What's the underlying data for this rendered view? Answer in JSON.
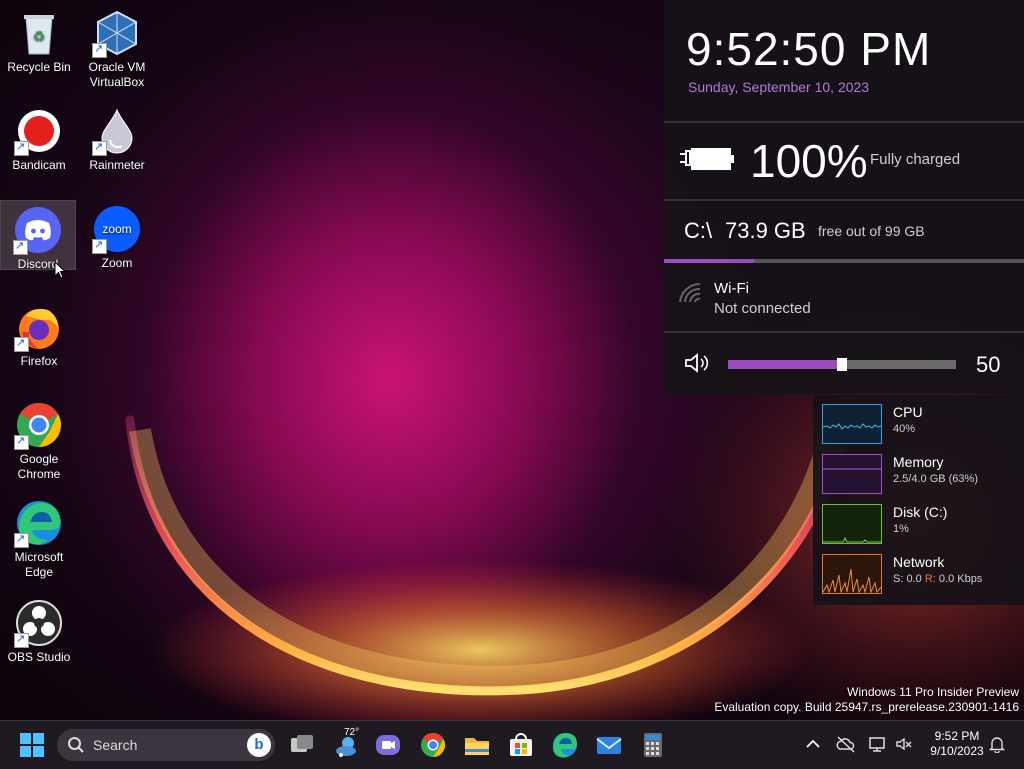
{
  "desktop": {
    "icons": [
      {
        "label": "Recycle Bin"
      },
      {
        "label": "Oracle VM VirtualBox"
      },
      {
        "label": "Bandicam"
      },
      {
        "label": "Rainmeter"
      },
      {
        "label": "Discord"
      },
      {
        "label": "Zoom"
      },
      {
        "label": "Firefox"
      },
      {
        "label": "Google Chrome"
      },
      {
        "label": "Microsoft Edge"
      },
      {
        "label": "OBS Studio"
      }
    ],
    "zoom_logo_text": "zoom"
  },
  "widgets": {
    "clock": {
      "time": "9:52:50 PM",
      "date": "Sunday, September 10, 2023"
    },
    "battery": {
      "value": "100%",
      "status": "Fully charged"
    },
    "disk": {
      "drive": "C:\\",
      "free": "73.9 GB",
      "total": "free out of 99 GB",
      "used_fraction": 0.25
    },
    "wifi": {
      "name": "Wi-Fi",
      "status": "Not connected"
    },
    "volume": {
      "level": 50,
      "display": "50"
    },
    "system": [
      {
        "name": "CPU",
        "detail": "40%",
        "color": "#3a9fe0"
      },
      {
        "name": "Memory",
        "detail": "2.5/4.0 GB (63%)",
        "color": "#a24fd0"
      },
      {
        "name": "Disk (C:)",
        "detail": "1%",
        "color": "#6ac02a"
      },
      {
        "name": "Network",
        "detail_send_label": "S:",
        "detail_send": "0.0",
        "detail_recv_label": "R:",
        "detail_recv": "0.0 Kbps",
        "color": "#e07a2a"
      }
    ]
  },
  "watermark": {
    "line1": "Windows 11 Pro Insider Preview",
    "line2": "Evaluation copy. Build 25947.rs_prerelease.230901-1416"
  },
  "taskbar": {
    "search_label": "Search",
    "search_bing_glyph": "b",
    "weather_temp": "72°",
    "tray_time": "9:52 PM",
    "tray_date": "9/10/2023",
    "icons": [
      "start-icon",
      "task-view-icon",
      "weather-icon",
      "teams-chat-icon",
      "chrome-icon",
      "file-explorer-icon",
      "microsoft-store-icon",
      "edge-icon",
      "mail-icon",
      "calculator-icon"
    ]
  }
}
